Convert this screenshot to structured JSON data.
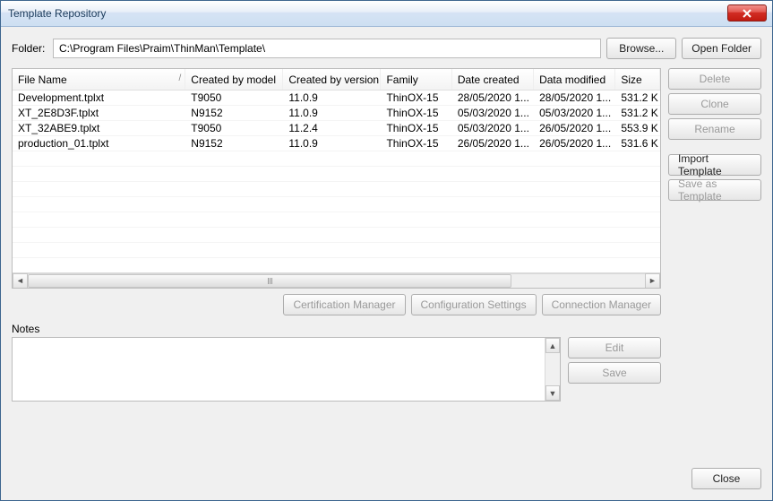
{
  "window": {
    "title": "Template Repository"
  },
  "folder": {
    "label": "Folder:",
    "path": "C:\\Program Files\\Praim\\ThinMan\\Template\\",
    "browse": "Browse...",
    "open": "Open Folder"
  },
  "columns": {
    "file": "File Name",
    "model": "Created by model",
    "version": "Created by version",
    "family": "Family",
    "created": "Date created",
    "modified": "Data modified",
    "size": "Size"
  },
  "rows": [
    {
      "file": "Development.tplxt",
      "model": "T9050",
      "version": "11.0.9",
      "family": "ThinOX-15",
      "created": "28/05/2020 1...",
      "modified": "28/05/2020 1...",
      "size": "531.2 K"
    },
    {
      "file": "XT_2E8D3F.tplxt",
      "model": "N9152",
      "version": "11.0.9",
      "family": "ThinOX-15",
      "created": "05/03/2020 1...",
      "modified": "05/03/2020 1...",
      "size": "531.2 K"
    },
    {
      "file": "XT_32ABE9.tplxt",
      "model": "T9050",
      "version": "11.2.4",
      "family": "ThinOX-15",
      "created": "05/03/2020 1...",
      "modified": "26/05/2020 1...",
      "size": "553.9 K"
    },
    {
      "file": "production_01.tplxt",
      "model": "N9152",
      "version": "11.0.9",
      "family": "ThinOX-15",
      "created": "26/05/2020 1...",
      "modified": "26/05/2020 1...",
      "size": "531.6 K"
    }
  ],
  "sidebar": {
    "delete": "Delete",
    "clone": "Clone",
    "rename": "Rename",
    "import": "Import Template",
    "saveas": "Save as Template"
  },
  "actions": {
    "cert": "Certification Manager",
    "config": "Configuration Settings",
    "conn": "Connection Manager"
  },
  "notes": {
    "label": "Notes",
    "edit": "Edit",
    "save": "Save"
  },
  "footer": {
    "close": "Close"
  }
}
